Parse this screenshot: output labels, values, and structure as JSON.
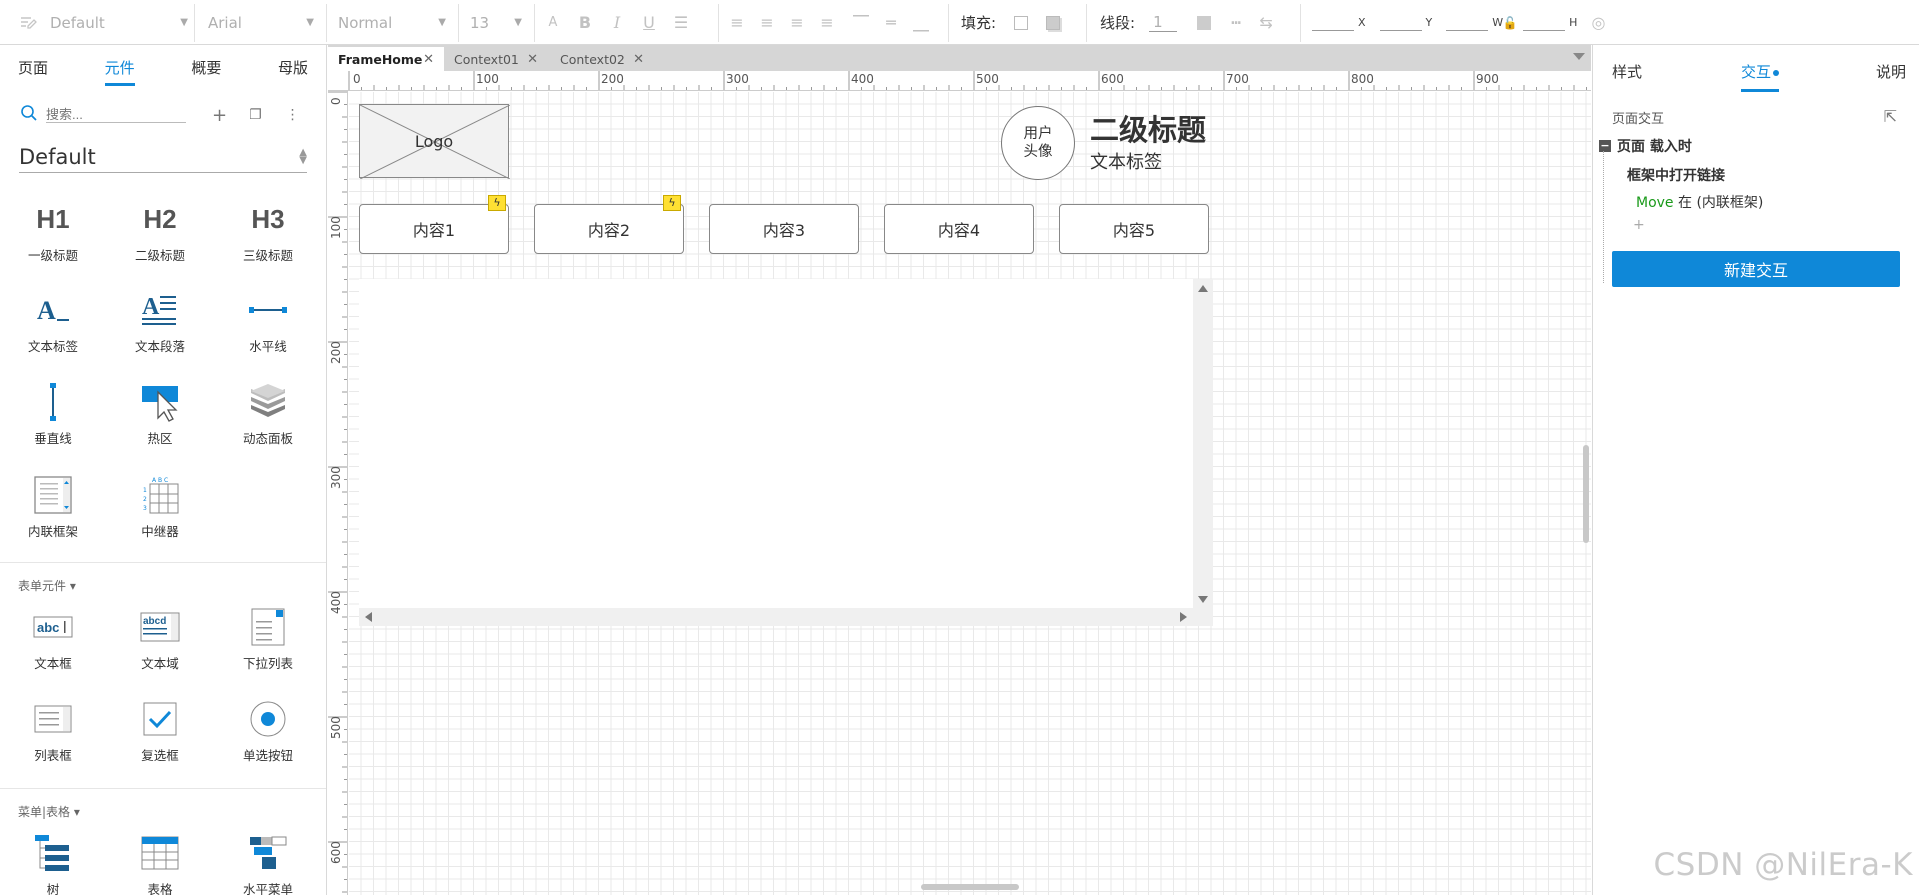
{
  "toolbar": {
    "style_select": "Default",
    "font_family": "Arial",
    "font_weight": "Normal",
    "font_size": "13",
    "fill_label": "填充:",
    "stroke_label": "线段:",
    "stroke_width": "1",
    "coord_x": "X",
    "coord_y": "Y",
    "coord_w": "W",
    "coord_h": "H"
  },
  "left_panel": {
    "tabs": [
      {
        "label": "页面"
      },
      {
        "label": "元件"
      },
      {
        "label": "概要"
      },
      {
        "label": "母版"
      }
    ],
    "active_tab": "元件",
    "search_placeholder": "搜索...",
    "library": "Default",
    "widgets": [
      {
        "icon": "H1",
        "label": "一级标题"
      },
      {
        "icon": "H2",
        "label": "二级标题"
      },
      {
        "icon": "H3",
        "label": "三级标题"
      },
      {
        "icon": "text-label-icon",
        "label": "文本标签"
      },
      {
        "icon": "text-paragraph-icon",
        "label": "文本段落"
      },
      {
        "icon": "horizontal-line-icon",
        "label": "水平线"
      },
      {
        "icon": "vertical-line-icon",
        "label": "垂直线"
      },
      {
        "icon": "hotspot-icon",
        "label": "热区"
      },
      {
        "icon": "dynamic-panel-icon",
        "label": "动态面板"
      },
      {
        "icon": "inline-frame-icon",
        "label": "内联框架"
      },
      {
        "icon": "repeater-icon",
        "label": "中继器"
      }
    ],
    "form_section": "表单元件",
    "form_widgets": [
      {
        "icon": "textbox-icon",
        "label": "文本框"
      },
      {
        "icon": "textarea-icon",
        "label": "文本域"
      },
      {
        "icon": "droplist-icon",
        "label": "下拉列表"
      },
      {
        "icon": "listbox-icon",
        "label": "列表框"
      },
      {
        "icon": "checkbox-icon",
        "label": "复选框"
      },
      {
        "icon": "radio-icon",
        "label": "单选按钮"
      }
    ],
    "menu_section": "菜单|表格",
    "menu_widgets": [
      {
        "icon": "tree-icon",
        "label": "树"
      },
      {
        "icon": "table-icon",
        "label": "表格"
      },
      {
        "icon": "horizontal-menu-icon",
        "label": "水平菜单"
      }
    ]
  },
  "doc_tabs": [
    {
      "label": "FrameHome",
      "active": true
    },
    {
      "label": "Context01",
      "active": false
    },
    {
      "label": "Context02",
      "active": false
    }
  ],
  "rulers": {
    "horizontal": [
      "0",
      "100",
      "200",
      "300",
      "400",
      "500",
      "600",
      "700",
      "800",
      "900"
    ],
    "vertical": [
      "0",
      "100",
      "200",
      "300",
      "400",
      "500",
      "600"
    ]
  },
  "canvas": {
    "logo_text": "Logo",
    "avatar_text_line1": "用户",
    "avatar_text_line2": "头像",
    "heading": "二级标题",
    "sub_label": "文本标签",
    "nav_buttons": [
      {
        "label": "内容1",
        "has_interaction": true
      },
      {
        "label": "内容2",
        "has_interaction": true
      },
      {
        "label": "内容3",
        "has_interaction": false
      },
      {
        "label": "内容4",
        "has_interaction": false
      },
      {
        "label": "内容5",
        "has_interaction": false
      }
    ]
  },
  "right_panel": {
    "tabs": [
      {
        "label": "样式"
      },
      {
        "label": "交互"
      },
      {
        "label": "说明"
      }
    ],
    "active_tab": "交互",
    "page_interactions_title": "页面交互",
    "event": "页面 载入时",
    "case": "框架中打开链接",
    "action_verb": "Move",
    "action_rest": " 在 (内联框架)",
    "add_symbol": "+",
    "new_interaction_button": "新建交互"
  },
  "watermark": "CSDN @NilEra-K",
  "colors": {
    "accent": "#0f88d8",
    "action_green": "#1a9a1a",
    "interaction_badge": "#ffe033"
  }
}
